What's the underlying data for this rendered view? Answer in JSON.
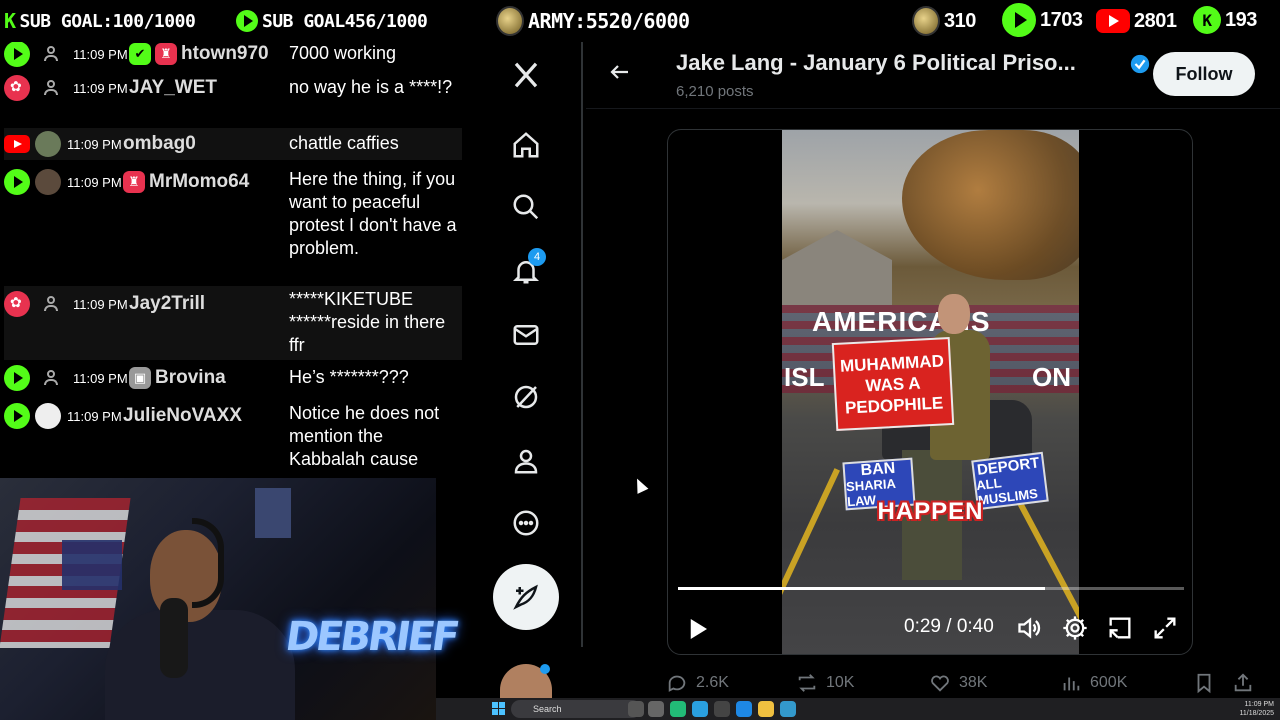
{
  "topbar": {
    "goals": [
      {
        "label": "SUB GOAL:100/1000"
      },
      {
        "label": "SUB GOAL456/1000"
      },
      {
        "label": "ARMY:5520/6000"
      }
    ],
    "stats": {
      "coin": "310",
      "rumble": "1703",
      "youtube": "2801",
      "kick": "193"
    }
  },
  "chat": {
    "messages": [
      {
        "platform": "rumble",
        "time": "11:09 PM",
        "user": "htown970",
        "text": "7000 working"
      },
      {
        "platform": "twitch",
        "time": "11:09 PM",
        "user": "JAY_WET",
        "text": "no way he is a ****!?"
      },
      {
        "platform": "youtube",
        "time": "11:09 PM",
        "user": "ombag0",
        "text": "chattle caffies"
      },
      {
        "platform": "rumble",
        "time": "11:09 PM",
        "user": "MrMomo64",
        "text": "Here the thing, if you want to peaceful protest I don't have a problem."
      },
      {
        "platform": "twitch",
        "time": "11:09 PM",
        "user": "Jay2Trill",
        "text": "*****KIKETUBE ******reside in there ffr"
      },
      {
        "platform": "rumble",
        "time": "11:09 PM",
        "user": "Brovina",
        "text": "He’s *******???"
      },
      {
        "platform": "rumble",
        "time": "11:09 PM",
        "user": "JulieNoVAXX",
        "text": "Notice he does not mention the Kabbalah cause"
      }
    ]
  },
  "webcam": {
    "overlay_text": "DEBRIEF"
  },
  "x_sidebar": {
    "notification_count": "4"
  },
  "profile": {
    "name": "Jake Lang - January 6 Political Priso...",
    "posts": "6,210 posts",
    "follow_label": "Follow"
  },
  "video": {
    "banner_text": "AMERICANS",
    "banner_left": "ISL",
    "banner_right": "ON",
    "red_sign": [
      "MUHAMMAD",
      "WAS A",
      "PEDOPHILE"
    ],
    "blue_sign_left": [
      "BAN",
      "SHARIA LAW"
    ],
    "blue_sign_right": [
      "DEPORT",
      "ALL MUSLIMS"
    ],
    "caption": "HAPPEN",
    "time": "0:29 / 0:40",
    "progress": 0.725
  },
  "actions": {
    "replies": "2.6K",
    "reposts": "10K",
    "likes": "38K",
    "views": "600K"
  },
  "taskbar": {
    "search_placeholder": "Search",
    "clock_time": "11:09 PM",
    "clock_date": "11/18/2025"
  }
}
